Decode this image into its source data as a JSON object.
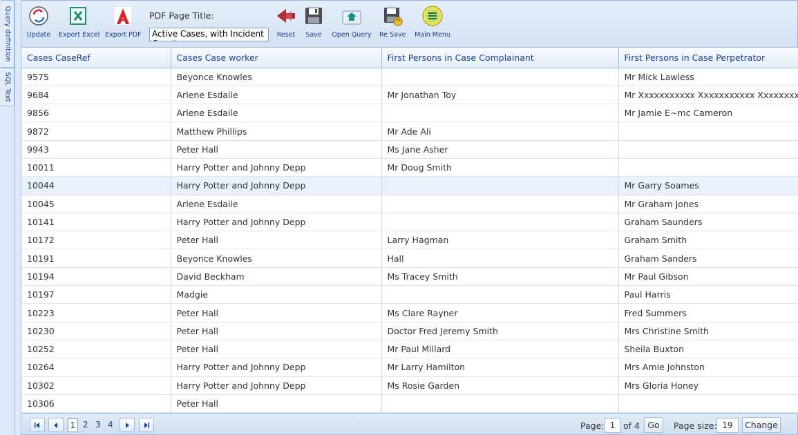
{
  "side_tabs": [
    "Query definition",
    "SQL Text"
  ],
  "toolbar": {
    "update": "Update",
    "export_excel": "Export Excel",
    "export_pdf": "Export PDF",
    "pdf_title_label": "PDF Page Title:",
    "pdf_title_value": "Active Cases, with Incident Count",
    "reset": "Reset",
    "save": "Save",
    "open_query": "Open Query",
    "re_save": "Re Save",
    "main_menu": "Main Menu"
  },
  "grid": {
    "columns": [
      "Cases CaseRef",
      "Cases Case worker",
      "First Persons in Case Complainant",
      "First Persons in Case Perpetrator"
    ],
    "rows": [
      [
        "9575",
        "Beyonce Knowles",
        "",
        "Mr Mick Lawless"
      ],
      [
        "9684",
        "Arlene Esdaile",
        "Mr Jonathan Toy",
        "Mr Xxxxxxxxxxx Xxxxxxxxxxx Xxxxxxxxxxx"
      ],
      [
        "9856",
        "Arlene Esdaile",
        "",
        "Mr Jamie E~mc Cameron"
      ],
      [
        "9872",
        "Matthew Phillips",
        "Mr Ade Ali",
        ""
      ],
      [
        "9943",
        "Peter Hall",
        "Ms Jane Asher",
        ""
      ],
      [
        "10011",
        "Harry Potter and Johnny Depp",
        "Mr Doug Smith",
        ""
      ],
      [
        "10044",
        "Harry Potter and Johnny Depp",
        "",
        "Mr Garry Soames"
      ],
      [
        "10045",
        "Arlene Esdaile",
        "",
        "Mr Graham Jones"
      ],
      [
        "10141",
        "Harry Potter and Johnny Depp",
        "",
        "Graham Saunders"
      ],
      [
        "10172",
        "Peter Hall",
        "Larry Hagman",
        "Graham Smith"
      ],
      [
        "10191",
        "Beyonce Knowles",
        "Hall",
        "Graham Sanders"
      ],
      [
        "10194",
        "David Beckham",
        "Ms Tracey Smith",
        "Mr Paul Gibson"
      ],
      [
        "10197",
        "Madgie",
        "",
        "Paul Harris"
      ],
      [
        "10223",
        "Peter Hall",
        "Ms Clare Rayner",
        "Fred Summers"
      ],
      [
        "10230",
        "Peter Hall",
        "Doctor Fred Jeremy Smith",
        "Mrs Christine Smith"
      ],
      [
        "10252",
        "Peter Hall",
        "Mr Paul Millard",
        "Sheila Buxton"
      ],
      [
        "10264",
        "Harry Potter and Johnny Depp",
        "Mr Larry Hamilton",
        "Mrs Amie Johnston"
      ],
      [
        "10302",
        "Harry Potter and Johnny Depp",
        "Ms Rosie Garden",
        "Mrs Gloria Honey"
      ],
      [
        "10306",
        "Peter Hall",
        "",
        ""
      ]
    ],
    "selected_row": 6
  },
  "pager": {
    "pages": [
      "1",
      "2",
      "3",
      "4"
    ],
    "current_page": "1",
    "page_label": "Page:",
    "page_value": "1",
    "of_label": "of 4",
    "go": "Go",
    "page_size_label": "Page size:",
    "page_size_value": "19",
    "change": "Change"
  },
  "colors": {
    "accent": "#15428b",
    "border": "#99bbe8",
    "excel": "#1d8f6b",
    "pdf": "#d8252b",
    "reset": "#b0303a"
  }
}
